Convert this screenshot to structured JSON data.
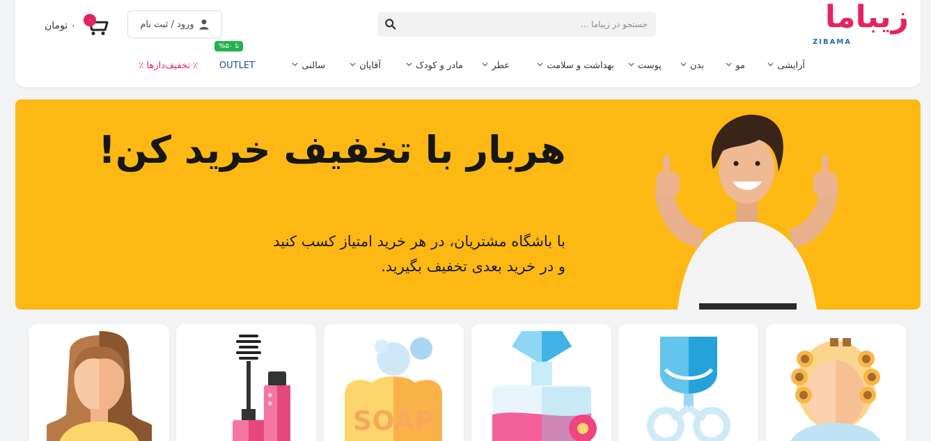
{
  "brand": {
    "name_fa": "زیباما",
    "name_en": "ZIBAMA",
    "accent": "#e6235f",
    "secondary": "#1a8ad2"
  },
  "search": {
    "placeholder": "جستجو در زیباما ...",
    "icon": "search-icon"
  },
  "account": {
    "login_label": "ورود / ثبت نام",
    "icon": "user-icon"
  },
  "cart": {
    "count": "۰",
    "total": "۰ تومان",
    "icon": "cart-icon"
  },
  "nav": {
    "items": [
      {
        "label": "آرایشی",
        "has_dropdown": true
      },
      {
        "label": "مو",
        "has_dropdown": true
      },
      {
        "label": "بدن",
        "has_dropdown": true
      },
      {
        "label": "پوست",
        "has_dropdown": true
      },
      {
        "label": "بهداشت و سلامت",
        "has_dropdown": true
      },
      {
        "label": "عطر",
        "has_dropdown": true
      },
      {
        "label": "مادر و کودک",
        "has_dropdown": true
      },
      {
        "label": "آقایان",
        "has_dropdown": true
      },
      {
        "label": "سالنی",
        "has_dropdown": true
      },
      {
        "label": "OUTLET",
        "has_dropdown": false,
        "badge": "تا ۵۰%"
      },
      {
        "label": "٪ تخفیف‌دارها ٪",
        "has_dropdown": false
      }
    ]
  },
  "banner": {
    "title": "هربار با تخفیف خرید کن!",
    "subtitle_line1": "با باشگاه مشتریان، در هر خرید امتیاز کسب کنید",
    "subtitle_line2": "و در خرید بعدی تخفیف بگیرید.",
    "background": "#fdb813"
  },
  "categories": [
    {
      "icon": "hair-curlers-icon"
    },
    {
      "icon": "eyelash-curler-icon"
    },
    {
      "icon": "perfume-icon"
    },
    {
      "icon": "soap-icon",
      "text": "SOAP"
    },
    {
      "icon": "mascara-icon"
    },
    {
      "icon": "woman-face-icon"
    }
  ]
}
